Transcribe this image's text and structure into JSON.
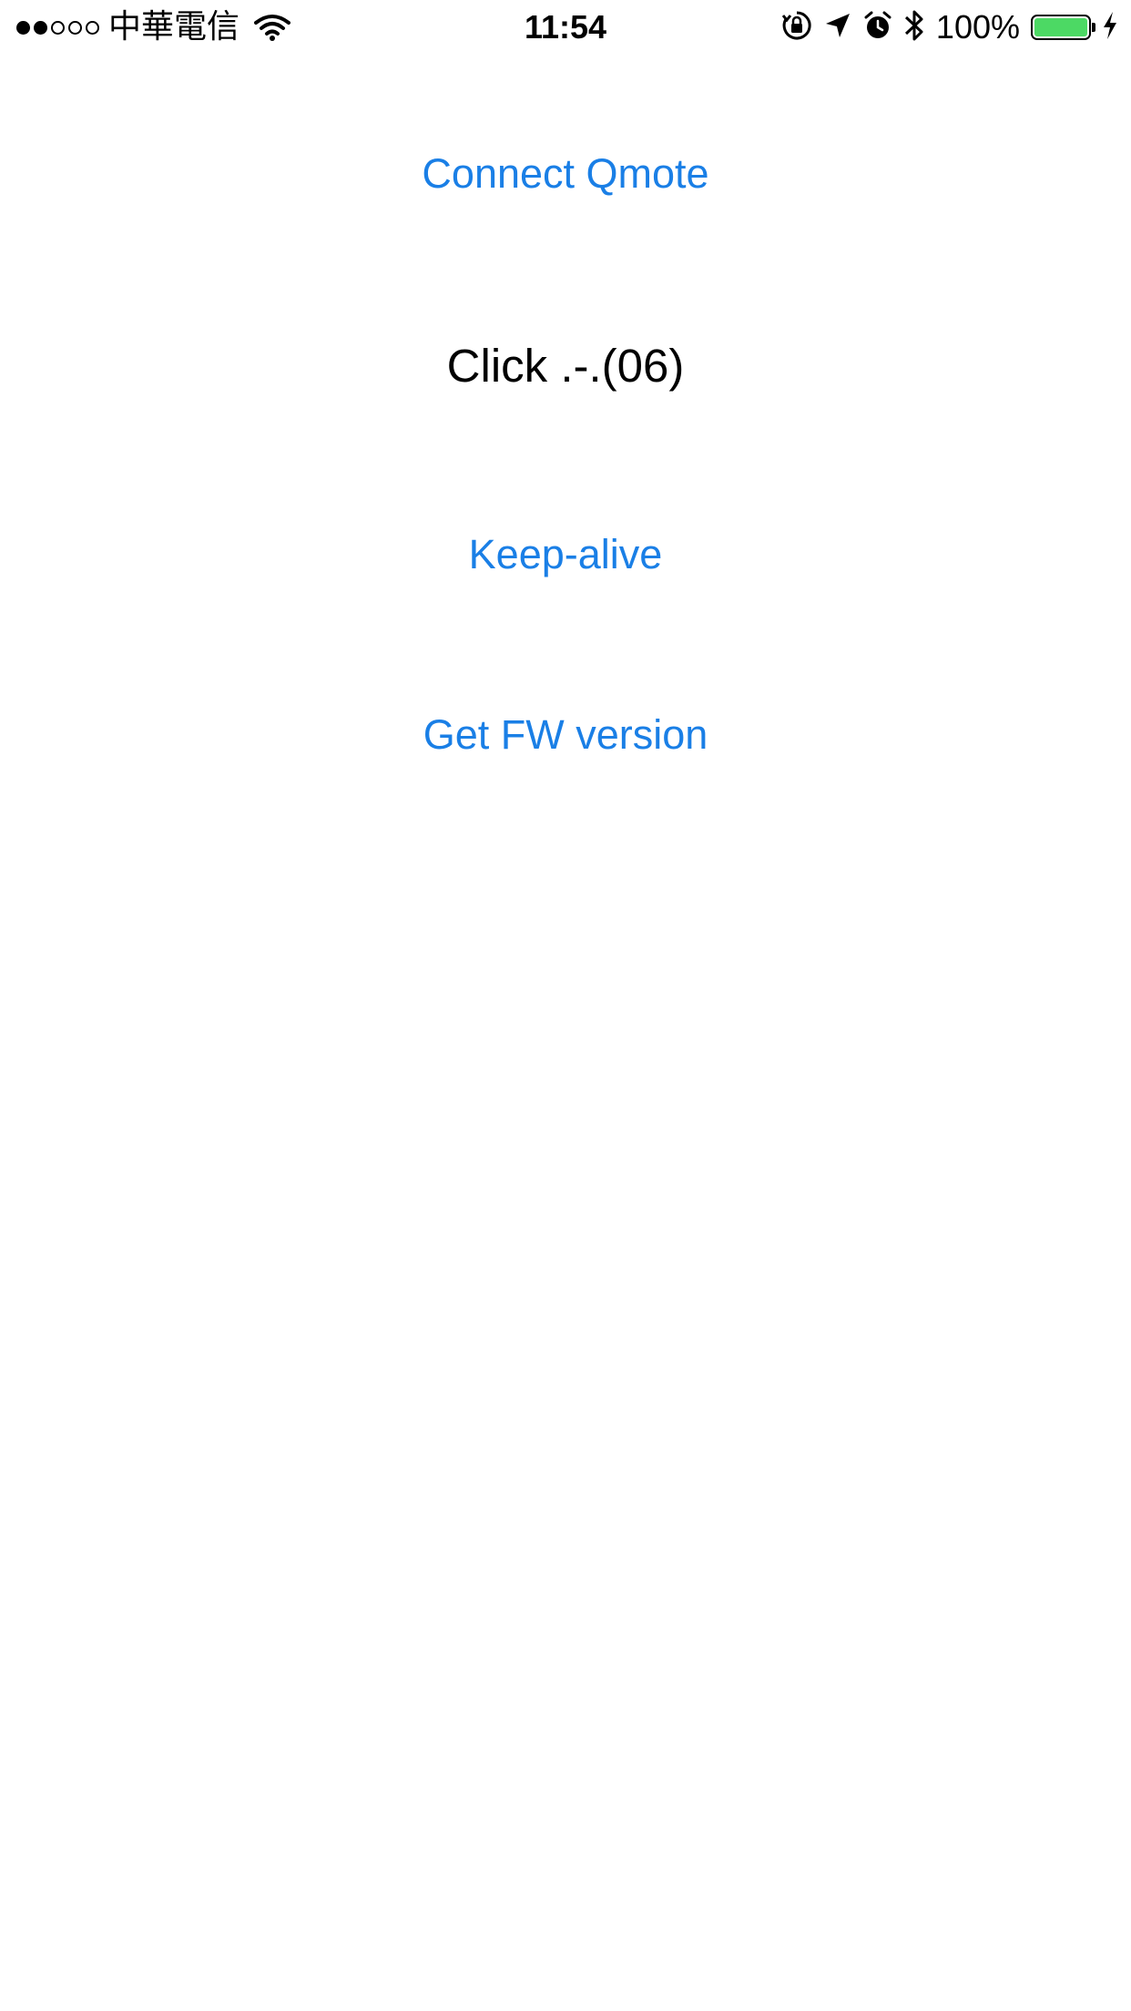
{
  "status_bar": {
    "signal_bars_filled": 2,
    "signal_bars_total": 5,
    "carrier": "中華電信",
    "time": "11:54",
    "battery_percent": "100%",
    "battery_level": 1.0,
    "battery_color": "#4cd964",
    "icons": [
      "wifi-icon",
      "rotation-lock-icon",
      "location-arrow-icon",
      "alarm-icon",
      "bluetooth-icon",
      "charging-bolt-icon"
    ]
  },
  "main": {
    "connect_label": "Connect Qmote",
    "click_status": "Click .-.(06)",
    "keepalive_label": "Keep-alive",
    "fw_label": "Get FW version"
  },
  "colors": {
    "accent": "#1a7fe6",
    "background": "#ffffff"
  }
}
